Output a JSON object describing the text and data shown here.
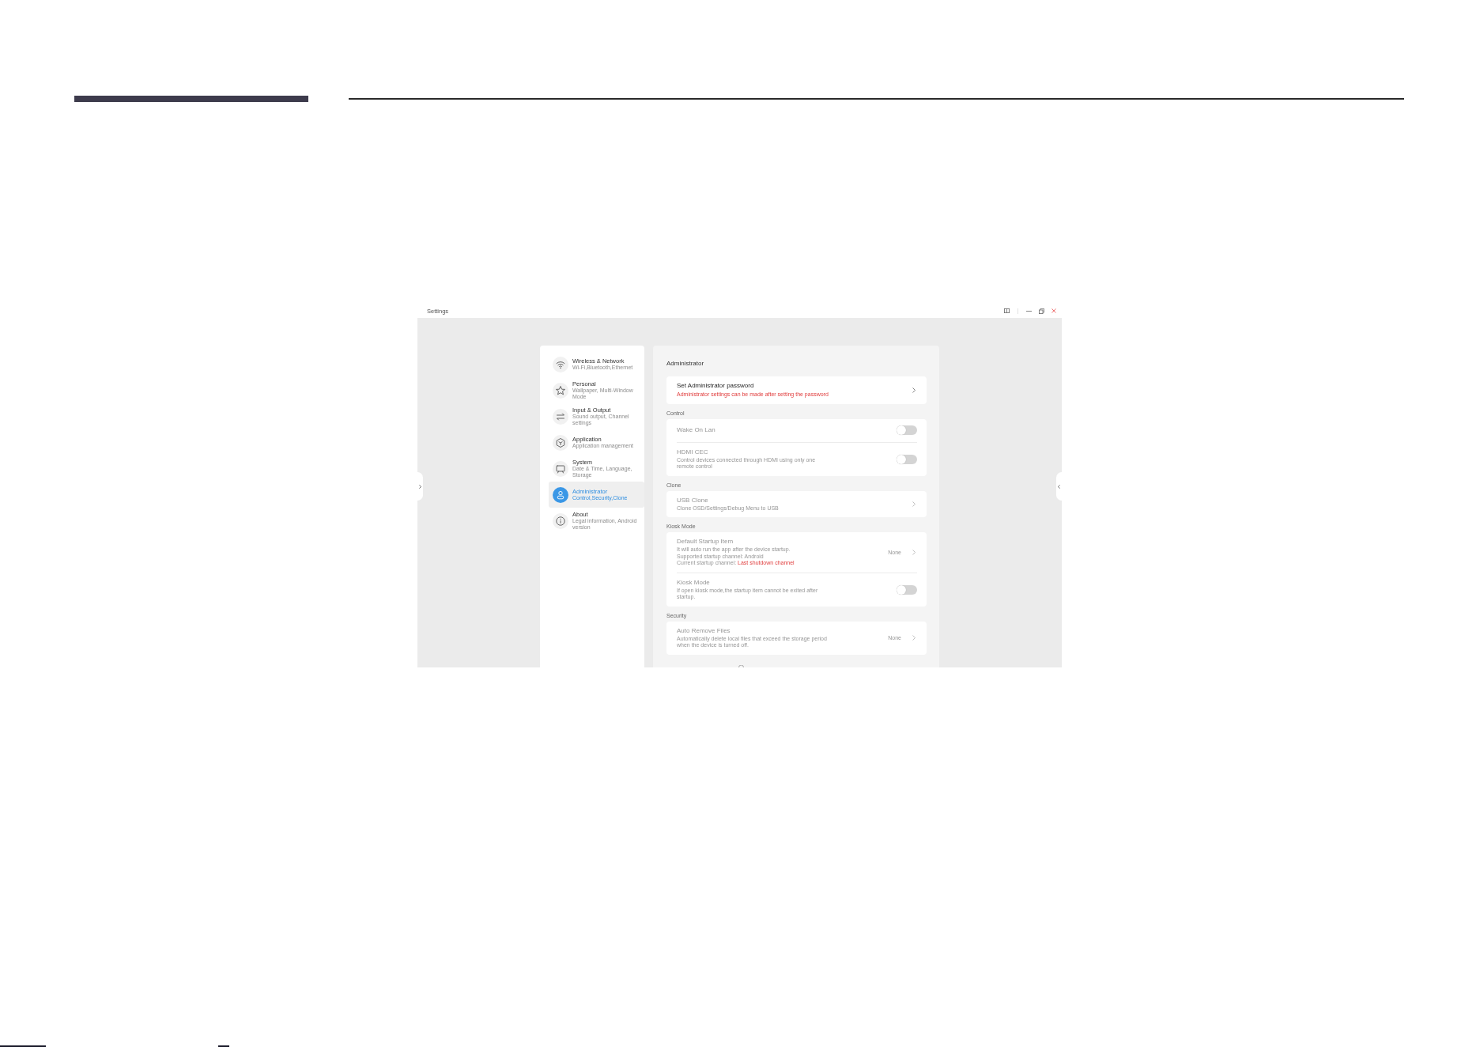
{
  "window": {
    "title": "Settings"
  },
  "sidebar": {
    "items": [
      {
        "title": "Wireless & Network",
        "subtitle": "Wi-Fi,Bluetooth,Ethernet",
        "selected": false
      },
      {
        "title": "Personal",
        "subtitle": "Wallpaper, Multi-Window Mode",
        "selected": false
      },
      {
        "title": "Input & Output",
        "subtitle": "Sound output, Channel settings",
        "selected": false
      },
      {
        "title": "Application",
        "subtitle": "Application management",
        "selected": false
      },
      {
        "title": "System",
        "subtitle": "Date & Time, Language, Storage",
        "selected": false
      },
      {
        "title": "Administrator",
        "subtitle": "Control,Security,Clone",
        "selected": true
      },
      {
        "title": "About",
        "subtitle": "Legal information, Android version",
        "selected": false
      }
    ]
  },
  "content": {
    "title": "Administrator",
    "sections": [
      {
        "rows": [
          {
            "kind": "link",
            "title": "Set Administrator password",
            "warning": "Administrator settings can be made after setting the password",
            "disabled": false
          }
        ]
      },
      {
        "label": "Control",
        "rows": [
          {
            "kind": "toggle",
            "title": "Wake On Lan",
            "on": false,
            "disabled": true
          },
          {
            "kind": "toggle",
            "title": "HDMI CEC",
            "description": [
              "Control devices connected through HDMI using only one",
              "remote control"
            ],
            "on": false,
            "disabled": true
          }
        ]
      },
      {
        "label": "Clone",
        "rows": [
          {
            "kind": "link",
            "title": "USB Clone",
            "description": [
              "Clone OSD/Settings/Debug Menu to USB"
            ],
            "disabled": true
          }
        ]
      },
      {
        "label": "Kiosk Mode",
        "rows": [
          {
            "kind": "link",
            "title": "Default Startup Item",
            "description": [
              "It will auto run the app after the device startup.",
              "Supported startup channel: Android"
            ],
            "current": {
              "label": "Current startup channel:",
              "value": "Last shutdown channel"
            },
            "value": "None",
            "disabled": true
          },
          {
            "kind": "toggle",
            "title": "Kiosk Mode",
            "description": [
              "If open kiosk mode,the startup item cannot be exited after",
              "startup."
            ],
            "on": false,
            "disabled": true
          }
        ]
      },
      {
        "label": "Security",
        "rows": [
          {
            "kind": "link",
            "title": "Auto Remove Files",
            "description": [
              "Automatically delete local files that exceed the storage period",
              "when the device is turned off."
            ],
            "value": "None",
            "disabled": true
          }
        ]
      }
    ]
  }
}
